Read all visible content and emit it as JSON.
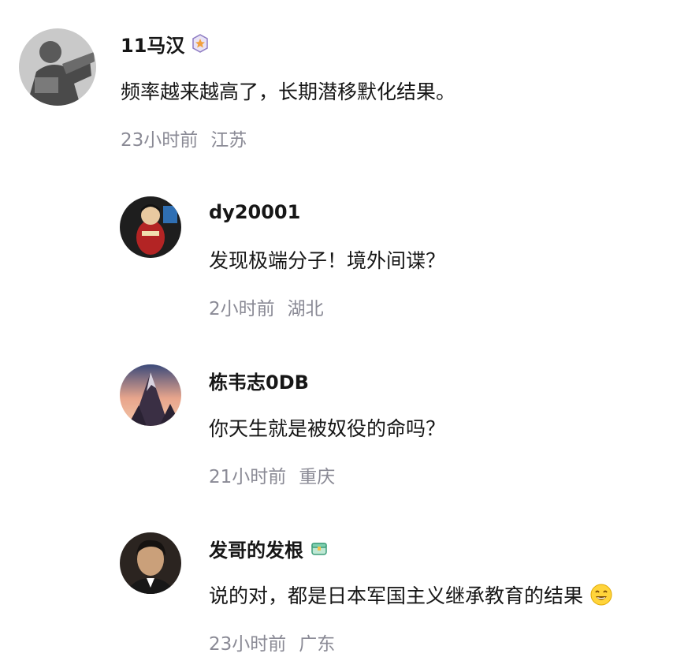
{
  "comments": [
    {
      "username": "11马汉",
      "badge_icon": "star-medal-icon",
      "text": "频率越来越高了，长期潜移默化结果。",
      "time": "23小时前",
      "location": "江苏"
    },
    {
      "username": "dy20001",
      "text": "发现极端分子！境外间谍？",
      "time": "2小时前",
      "location": "湖北"
    },
    {
      "username": "栋韦志0DB",
      "text": "你天生就是被奴役的命吗？",
      "time": "21小时前",
      "location": "重庆"
    },
    {
      "username": "发哥的发根",
      "badge_icon": "treasure-box-icon",
      "text": "说的对，都是日本军国主义继承教育的结果",
      "emoji_icon": "grinning-emoji-icon",
      "time": "23小时前",
      "location": "广东"
    }
  ],
  "colors": {
    "text_primary": "#161616",
    "text_secondary": "#8a8a95"
  }
}
